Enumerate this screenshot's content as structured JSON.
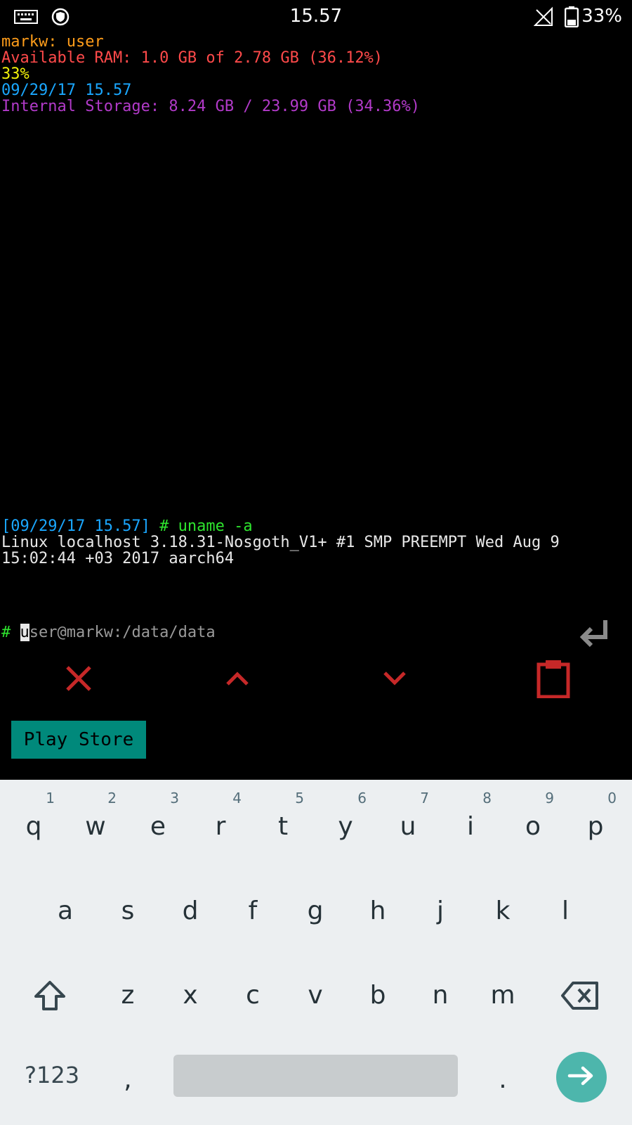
{
  "status_bar": {
    "time": "15.57",
    "battery": "33%",
    "icons": [
      "keyboard-icon",
      "vpn-shield-icon",
      "no-signal-icon",
      "battery-icon"
    ]
  },
  "terminal": {
    "motd": [
      {
        "text": "markw: user",
        "color": "#ff9d1a"
      },
      {
        "text": "Available RAM: 1.0 GB of 2.78 GB (36.12%)",
        "color": "#ff4a4a"
      },
      {
        "text": "33%",
        "color": "#f2f20a"
      },
      {
        "text": "09/29/17 15.57",
        "color": "#1aa7ff"
      },
      {
        "text": "Internal Storage: 8.24 GB / 23.99 GB (34.36%)",
        "color": "#b23ac9"
      }
    ],
    "prompt_timestamp": "[09/29/17 15.57]",
    "prompt_command": " # uname -a",
    "output_line1": "Linux localhost 3.18.31-Nosgoth_V1+ #1 SMP PREEMPT Wed Aug 9",
    "output_line2": "15:02:44 +03 2017 aarch64",
    "input_prefix": "# ",
    "input_cursor_char": "u",
    "input_hint_rest": "ser@markw:/data/data"
  },
  "toolbar": {
    "play_store_label": "Play Store"
  },
  "keyboard": {
    "row1": [
      {
        "hint": "1",
        "key": "q"
      },
      {
        "hint": "2",
        "key": "w"
      },
      {
        "hint": "3",
        "key": "e"
      },
      {
        "hint": "4",
        "key": "r"
      },
      {
        "hint": "5",
        "key": "t"
      },
      {
        "hint": "6",
        "key": "y"
      },
      {
        "hint": "7",
        "key": "u"
      },
      {
        "hint": "8",
        "key": "i"
      },
      {
        "hint": "9",
        "key": "o"
      },
      {
        "hint": "0",
        "key": "p"
      }
    ],
    "row2": [
      "a",
      "s",
      "d",
      "f",
      "g",
      "h",
      "j",
      "k",
      "l"
    ],
    "row3": [
      "z",
      "x",
      "c",
      "v",
      "b",
      "n",
      "m"
    ],
    "symbols_label": "?123",
    "comma": ",",
    "period": ".",
    "accent_color": "#4db6ac"
  }
}
